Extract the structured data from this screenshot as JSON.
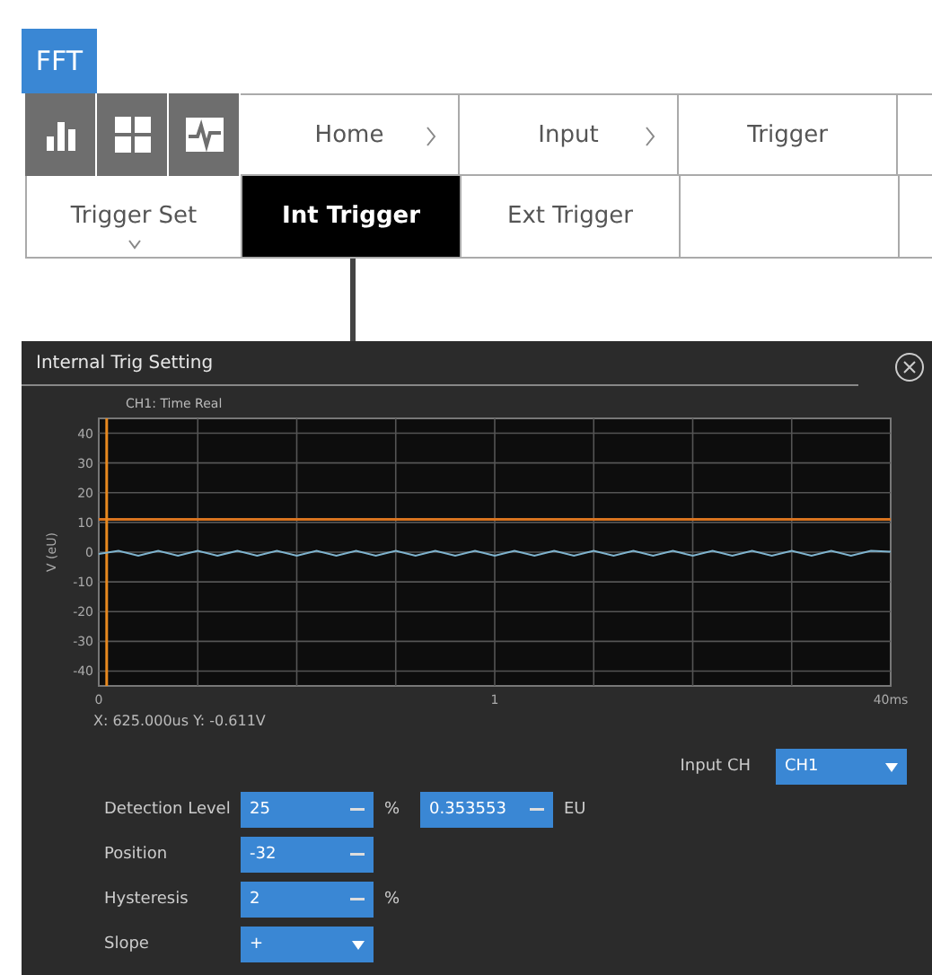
{
  "app_badge": "FFT",
  "breadcrumb": [
    {
      "label": "Home",
      "has_next": true
    },
    {
      "label": "Input",
      "has_next": true
    },
    {
      "label": "Trigger",
      "has_next": false
    }
  ],
  "tabs": [
    {
      "label": "Trigger Set",
      "selected": false,
      "has_menu": true
    },
    {
      "label": "Int Trigger",
      "selected": true,
      "has_menu": false
    },
    {
      "label": "Ext Trigger",
      "selected": false,
      "has_menu": false
    }
  ],
  "dialog": {
    "title": "Internal Trig Setting",
    "chart": {
      "chart_data": {
        "type": "line",
        "title": "CH1: Time Real",
        "ylabel": "V (eU)",
        "xlim": [
          0,
          40
        ],
        "ylim": [
          -45,
          45
        ],
        "grid": true,
        "xticks": [
          {
            "value": 0,
            "label": "0"
          },
          {
            "value": 40,
            "label": "40ms"
          }
        ],
        "yticks": [
          40,
          30,
          20,
          10,
          0,
          -10,
          -20,
          -30,
          -40
        ],
        "x": [
          0,
          1,
          2,
          3,
          4,
          5,
          6,
          7,
          8,
          9,
          10,
          11,
          12,
          13,
          14,
          15,
          16,
          17,
          18,
          19,
          20,
          21,
          22,
          23,
          24,
          25,
          26,
          27,
          28,
          29,
          30,
          31,
          32,
          33,
          34,
          35,
          36,
          37,
          38,
          39,
          40
        ],
        "series": [
          {
            "color": "#7fb4cf",
            "values": [
              -0.6,
              0.4,
              -1.2,
              0.4,
              -1.2,
              0.4,
              -1.2,
              0.4,
              -1.2,
              0.4,
              -1.2,
              0.4,
              -1.2,
              0.4,
              -1.2,
              0.4,
              -1.2,
              0.4,
              -1.2,
              0.4,
              -1.2,
              0.4,
              -1.2,
              0.4,
              -1.2,
              0.4,
              -1.2,
              0.4,
              -1.2,
              0.4,
              -1.2,
              0.4,
              -1.2,
              0.4,
              -1.2,
              0.4,
              -1.2,
              0.4,
              -1.2,
              0.4,
              0.2
            ]
          }
        ],
        "ref_lines": [
          {
            "axis": "y",
            "value": 11,
            "color": "#d9731f"
          },
          {
            "axis": "x",
            "value": 0.4,
            "color": "#e8891f"
          }
        ]
      },
      "mid_axis_label": "1",
      "cursor_readout": "X: 625.000us Y: -0.611V"
    },
    "input_ch": {
      "label": "Input CH",
      "value": "CH1"
    },
    "rows": [
      {
        "label": "Detection Level",
        "kind": "field",
        "value": "25",
        "unit": "%",
        "extra_value": "0.353553",
        "extra_unit": "EU"
      },
      {
        "label": "Position",
        "kind": "field",
        "value": "-32"
      },
      {
        "label": "Hysteresis",
        "kind": "field",
        "value": "2",
        "unit": "%"
      },
      {
        "label": "Slope",
        "kind": "dropdown",
        "value": "+"
      }
    ]
  }
}
